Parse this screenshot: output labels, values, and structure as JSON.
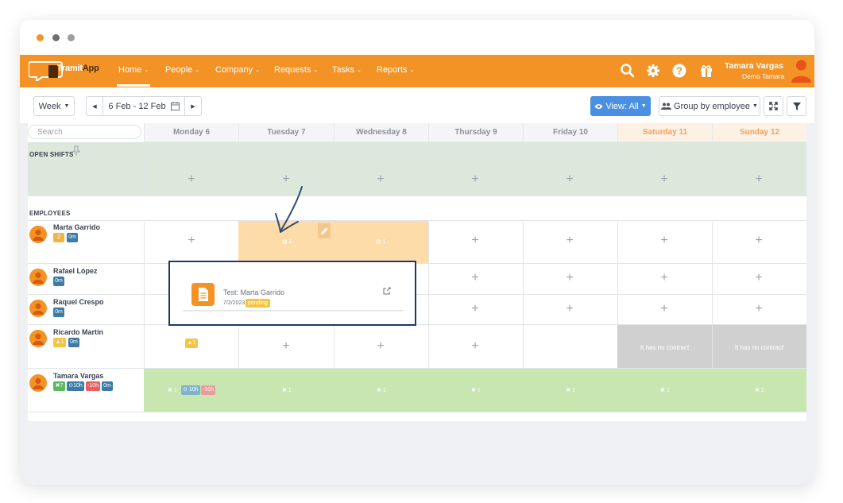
{
  "window": {
    "dots": [
      "#f39325",
      "#6b6e73",
      "#9a9da2"
    ]
  },
  "app": {
    "logo_text": "Tramit",
    "logo_text2": "App"
  },
  "nav": {
    "items": [
      {
        "label": "Home",
        "active": true
      },
      {
        "label": "People"
      },
      {
        "label": "Company"
      },
      {
        "label": "Requests"
      },
      {
        "label": "Tasks"
      },
      {
        "label": "Reports"
      }
    ],
    "caret": "⌄"
  },
  "user": {
    "name": "Tamara Vargas",
    "company": "Demo Tamara"
  },
  "toolbar": {
    "range_mode": "Week",
    "date_range": "6 Feb - 12 Feb",
    "view_label": "View: All",
    "group_label": "Group by employee"
  },
  "grid": {
    "search_placeholder": "Search",
    "days": [
      {
        "label": "Monday 6",
        "weekend": false
      },
      {
        "label": "Tuesday 7",
        "weekend": false
      },
      {
        "label": "Wednesday 8",
        "weekend": false
      },
      {
        "label": "Thursday 9",
        "weekend": false
      },
      {
        "label": "Friday 10",
        "weekend": false
      },
      {
        "label": "Saturday 11",
        "weekend": true
      },
      {
        "label": "Sunday 12",
        "weekend": true
      }
    ],
    "open_shifts_label": "OPEN SHIFTS",
    "employees_label": "EMPLOYEES",
    "plus": "+",
    "no_contract": "It has no contract"
  },
  "employees": [
    {
      "name": "Marta Garrido",
      "badges": [
        {
          "text": "2",
          "color": "orange"
        },
        {
          "text": "0m",
          "color": "blue"
        }
      ]
    },
    {
      "name": "Rafael López",
      "badges": [
        {
          "text": "0m",
          "color": "blue"
        }
      ]
    },
    {
      "name": "Raquel Crespo",
      "badges": [
        {
          "text": "0m",
          "color": "blue"
        }
      ]
    },
    {
      "name": "Ricardo Martín",
      "badges": [
        {
          "text": "1",
          "color": "yellow"
        },
        {
          "text": "0m",
          "color": "blue"
        }
      ]
    },
    {
      "name": "Tamara Vargas",
      "badges": [
        {
          "text": "7",
          "color": "green"
        },
        {
          "text": "10h",
          "color": "blue"
        },
        {
          "text": "-10h",
          "color": "red"
        },
        {
          "text": "0m",
          "color": "blue"
        }
      ]
    }
  ],
  "shifts": {
    "marta_tue": "1",
    "marta_wed": "1",
    "ricardo_mon": "1",
    "tamara_mon": "1",
    "tamara_mon_hours": "10h",
    "tamara_mon_diff": "-10h",
    "tamara_day": "1"
  },
  "popup": {
    "title": "Test: Marta Garrido",
    "date": "7/2/2023",
    "status": "pending"
  }
}
